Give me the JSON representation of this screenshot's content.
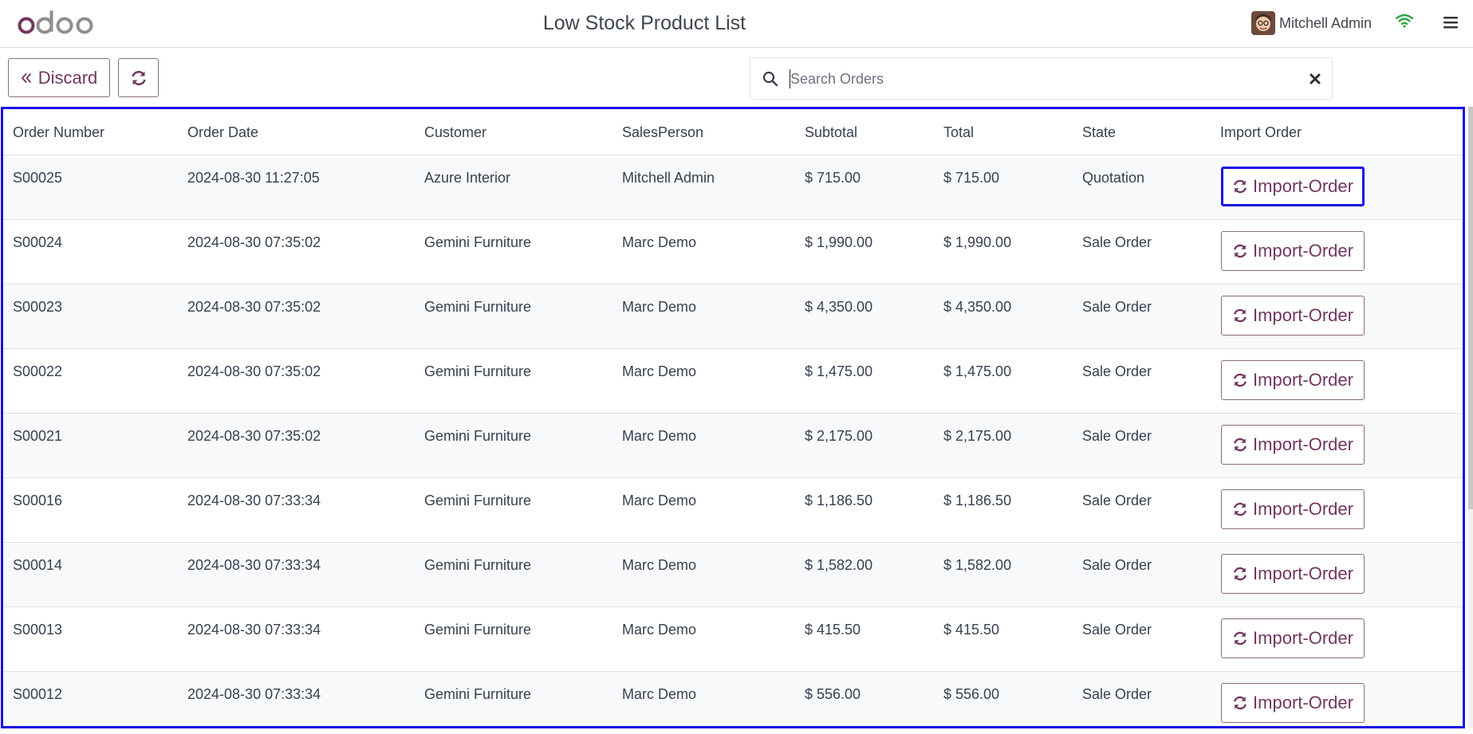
{
  "header": {
    "title": "Low Stock Product List",
    "user_name": "Mitchell Admin"
  },
  "toolbar": {
    "discard_label": "Discard"
  },
  "search": {
    "placeholder": "Search Orders",
    "value": ""
  },
  "table": {
    "columns": [
      "Order Number",
      "Order Date",
      "Customer",
      "SalesPerson",
      "Subtotal",
      "Total",
      "State",
      "Import Order"
    ],
    "button_label": "Import-Order",
    "rows": [
      {
        "order": "S00025",
        "date": "2024-08-30 11:27:05",
        "customer": "Azure Interior",
        "salesperson": "Mitchell Admin",
        "subtotal": "$ 715.00",
        "total": "$ 715.00",
        "state": "Quotation"
      },
      {
        "order": "S00024",
        "date": "2024-08-30 07:35:02",
        "customer": "Gemini Furniture",
        "salesperson": "Marc Demo",
        "subtotal": "$ 1,990.00",
        "total": "$ 1,990.00",
        "state": "Sale Order"
      },
      {
        "order": "S00023",
        "date": "2024-08-30 07:35:02",
        "customer": "Gemini Furniture",
        "salesperson": "Marc Demo",
        "subtotal": "$ 4,350.00",
        "total": "$ 4,350.00",
        "state": "Sale Order"
      },
      {
        "order": "S00022",
        "date": "2024-08-30 07:35:02",
        "customer": "Gemini Furniture",
        "salesperson": "Marc Demo",
        "subtotal": "$ 1,475.00",
        "total": "$ 1,475.00",
        "state": "Sale Order"
      },
      {
        "order": "S00021",
        "date": "2024-08-30 07:35:02",
        "customer": "Gemini Furniture",
        "salesperson": "Marc Demo",
        "subtotal": "$ 2,175.00",
        "total": "$ 2,175.00",
        "state": "Sale Order"
      },
      {
        "order": "S00016",
        "date": "2024-08-30 07:33:34",
        "customer": "Gemini Furniture",
        "salesperson": "Marc Demo",
        "subtotal": "$ 1,186.50",
        "total": "$ 1,186.50",
        "state": "Sale Order"
      },
      {
        "order": "S00014",
        "date": "2024-08-30 07:33:34",
        "customer": "Gemini Furniture",
        "salesperson": "Marc Demo",
        "subtotal": "$ 1,582.00",
        "total": "$ 1,582.00",
        "state": "Sale Order"
      },
      {
        "order": "S00013",
        "date": "2024-08-30 07:33:34",
        "customer": "Gemini Furniture",
        "salesperson": "Marc Demo",
        "subtotal": "$ 415.50",
        "total": "$ 415.50",
        "state": "Sale Order"
      },
      {
        "order": "S00012",
        "date": "2024-08-30 07:33:34",
        "customer": "Gemini Furniture",
        "salesperson": "Marc Demo",
        "subtotal": "$ 556.00",
        "total": "$ 556.00",
        "state": "Sale Order"
      }
    ]
  },
  "icons": {
    "logo": "odoo-logo",
    "discard": "double-chevron-left-icon",
    "refresh": "refresh-icon",
    "search": "search-icon",
    "clear": "close-icon",
    "wifi": "wifi-icon",
    "menu": "hamburger-menu-icon"
  },
  "colors": {
    "brand": "#71375f",
    "focus": "#1a10e6",
    "wifi": "#28a745"
  }
}
